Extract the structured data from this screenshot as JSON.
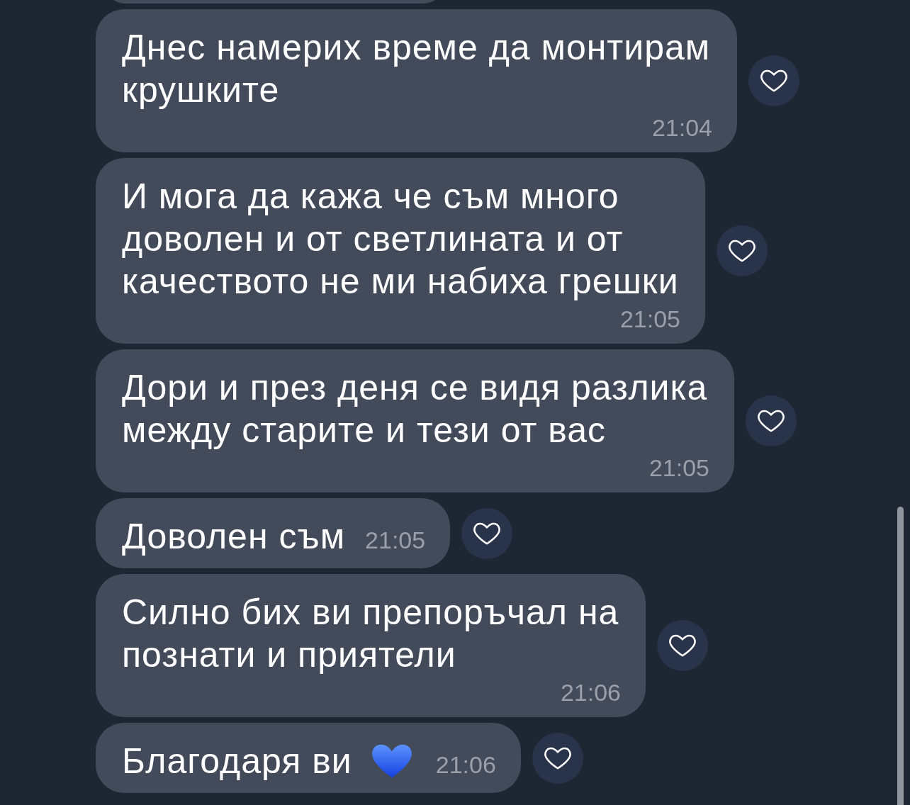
{
  "messages": [
    {
      "kind": "clipped"
    },
    {
      "kind": "text",
      "text": "Днес намерих време да монтирам крушките",
      "time": "21:04",
      "emoji": false
    },
    {
      "kind": "text",
      "text": "И мога да кажа че съм много доволен и от светлината и от качеството не ми набиха грешки",
      "time": "21:05",
      "emoji": false
    },
    {
      "kind": "text",
      "text": "Дори и през деня се видя разлика между старите и тези от вас",
      "time": "21:05",
      "emoji": false
    },
    {
      "kind": "text",
      "text": "Доволен съм",
      "time": "21:05",
      "emoji": false
    },
    {
      "kind": "text",
      "text": "Силно бих ви препоръчал на познати и приятели",
      "time": "21:06",
      "emoji": false
    },
    {
      "kind": "text",
      "text": "Благодаря ви",
      "time": "21:06",
      "emoji": true
    }
  ]
}
